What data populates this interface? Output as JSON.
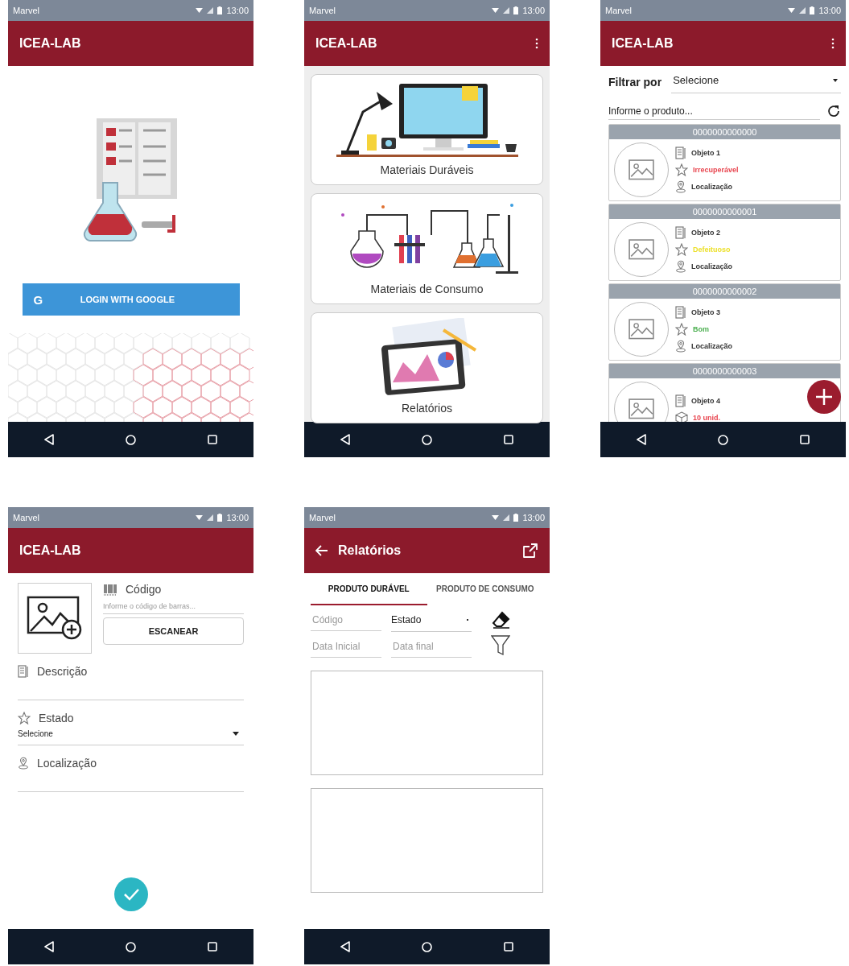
{
  "screens": [
    {
      "kind": "login",
      "status_bar": {
        "carrier": "Marvel",
        "time": "13:00"
      },
      "app_bar": {
        "title": "ICEA-LAB",
        "overflow_menu": false
      },
      "login_button": {
        "icon_letter": "G",
        "label": "LOGIN WITH GOOGLE"
      }
    },
    {
      "kind": "menu",
      "status_bar": {
        "carrier": "Marvel",
        "time": "13:00"
      },
      "app_bar": {
        "title": "ICEA-LAB",
        "overflow_menu": true
      },
      "cards": [
        {
          "kind": "durable",
          "label": "Materiais Duráveis"
        },
        {
          "kind": "consumable",
          "label": "Materiais de Consumo"
        },
        {
          "kind": "reports",
          "label": "Relatórios"
        }
      ]
    },
    {
      "kind": "list",
      "status_bar": {
        "carrier": "Marvel",
        "time": "13:00"
      },
      "app_bar": {
        "title": "ICEA-LAB",
        "overflow_menu": true
      },
      "filter": {
        "label": "Filtrar por",
        "value": "Selecione"
      },
      "search": {
        "placeholder": "Informe o produto..."
      },
      "items": [
        {
          "code": "0000000000000",
          "name": "Objeto 1",
          "kind": "durable",
          "status": "Irrecuperável",
          "color": "#e8454f",
          "location": "Localização"
        },
        {
          "code": "0000000000001",
          "name": "Objeto 2",
          "kind": "durable",
          "status": "Defeituoso",
          "color": "#ece02a",
          "location": "Localização"
        },
        {
          "code": "0000000000002",
          "name": "Objeto 3",
          "kind": "durable",
          "status": "Bom",
          "color": "#4caf50",
          "location": "Localização"
        },
        {
          "code": "0000000000003",
          "name": "Objeto 4",
          "kind": "consumable",
          "status": "10 unid.",
          "color": "#e8454f"
        }
      ]
    },
    {
      "kind": "form",
      "status_bar": {
        "carrier": "Marvel",
        "time": "13:00"
      },
      "app_bar": {
        "title": "ICEA-LAB",
        "overflow_menu": false
      },
      "code": {
        "label": "Código",
        "placeholder": "Informe o código de barras..."
      },
      "scan_button": "ESCANEAR",
      "fields": [
        {
          "kind": "text",
          "label": "Descrição"
        },
        {
          "kind": "select",
          "label": "Estado",
          "value": "Selecione"
        },
        {
          "kind": "location",
          "label": "Localização"
        }
      ]
    },
    {
      "kind": "reports",
      "status_bar": {
        "carrier": "Marvel",
        "time": "13:00"
      },
      "app_bar": {
        "title": "Relatórios",
        "back": true,
        "export": true
      },
      "tabs": [
        {
          "label": "PRODUTO DURÁVEL",
          "selected": true
        },
        {
          "label": "PRODUTO DE CONSUMO",
          "selected": false
        }
      ],
      "filters": [
        {
          "kind": "text",
          "placeholder": "Código"
        },
        {
          "kind": "select",
          "value": "Estado"
        },
        {
          "kind": "text",
          "placeholder": "Data Inicial"
        },
        {
          "kind": "text",
          "placeholder": "Data final"
        }
      ]
    }
  ]
}
